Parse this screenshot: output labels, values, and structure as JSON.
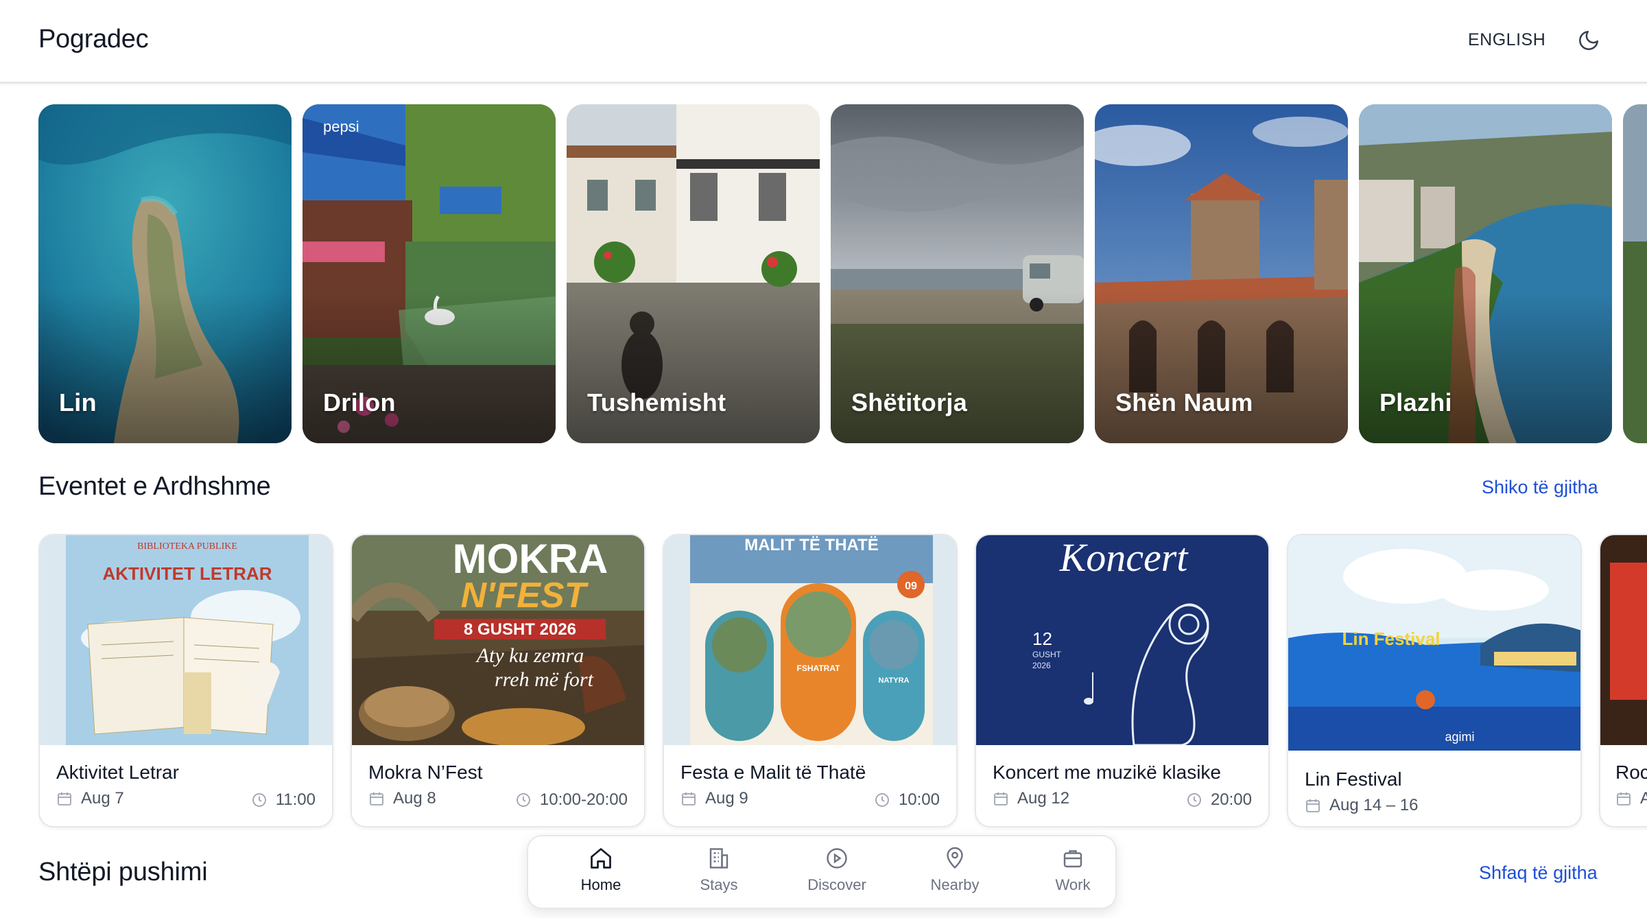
{
  "header": {
    "title": "Pogradec",
    "language_label": "ENGLISH",
    "theme_icon": "moon-icon"
  },
  "places": [
    {
      "label": "Lin"
    },
    {
      "label": "Drilon"
    },
    {
      "label": "Tushemisht"
    },
    {
      "label": "Shëtitorja"
    },
    {
      "label": "Shën Naum"
    },
    {
      "label": "Plazhi"
    }
  ],
  "events_section": {
    "title": "Eventet e Ardhshme",
    "link": "Shiko të gjitha",
    "items": [
      {
        "name": "Aktivitet Letrar",
        "date": "Aug 7",
        "time": "11:00",
        "poster": {
          "line1": "BIBLIOTEKA PUBLIKE",
          "line2": "AKTIVITET LETRAR"
        }
      },
      {
        "name": "Mokra N’Fest",
        "date": "Aug 8",
        "time": "10:00-20:00",
        "poster": {
          "line1": "MOKRA",
          "line2": "N'FEST",
          "line3": "8 GUSHT 2026",
          "line4": "Aty ku zemra",
          "line5": "rreh më fort"
        }
      },
      {
        "name": "Festa e Malit të Thatë",
        "date": "Aug 9",
        "time": "10:00",
        "poster": {
          "line1": "MALIT TË THATË",
          "line2": "FSHATRAT",
          "line3": "NATYRA",
          "line4": "09"
        }
      },
      {
        "name": "Koncert me muzikë klasike",
        "date": "Aug 12",
        "time": "20:00",
        "poster": {
          "line1": "Koncert",
          "line2": "12",
          "line3": "GUSHT",
          "line4": "2026"
        }
      },
      {
        "name": "Lin Festival",
        "date": "Aug 14 – 16",
        "time": "",
        "poster": {
          "line1": "Lin Festival",
          "line2": "agimi"
        }
      }
    ],
    "partial_next": {
      "name": "Roc",
      "date": "A"
    }
  },
  "stays_section": {
    "title": "Shtëpi pushimi",
    "link": "Shfaq të gjitha"
  },
  "bottom_nav": {
    "items": [
      {
        "label": "Home",
        "icon": "home-icon",
        "active": true
      },
      {
        "label": "Stays",
        "icon": "building-icon",
        "active": false
      },
      {
        "label": "Discover",
        "icon": "play-circle-icon",
        "active": false
      },
      {
        "label": "Nearby",
        "icon": "map-pin-icon",
        "active": false
      },
      {
        "label": "Work",
        "icon": "briefcase-icon",
        "active": false
      }
    ]
  },
  "colors": {
    "link": "#1d4ed8",
    "text": "#111827",
    "muted": "#4b5563"
  }
}
